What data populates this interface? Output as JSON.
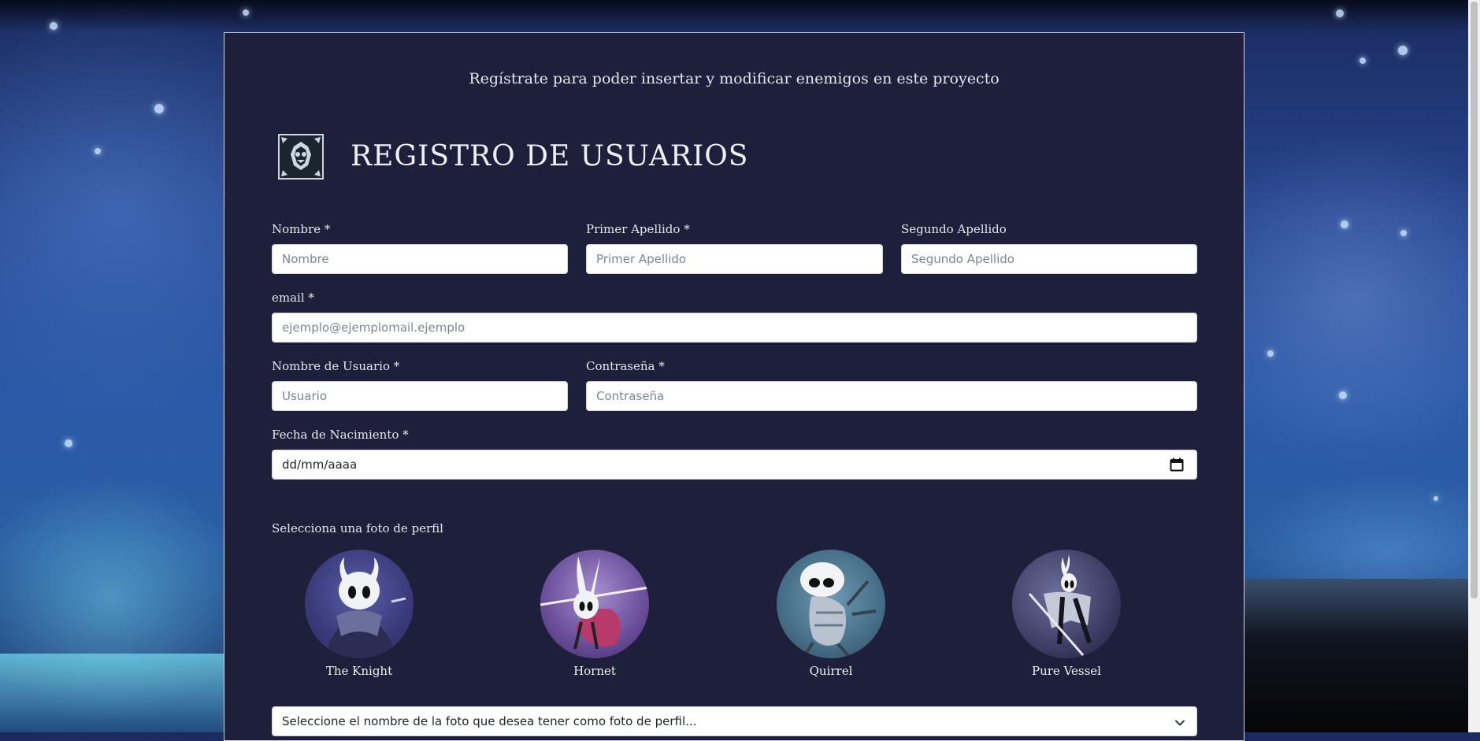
{
  "page": {
    "subtitle": "Regístrate para poder insertar y modificar enemigos en este proyecto",
    "title": "REGISTRO DE USUARIOS"
  },
  "form": {
    "nombre": {
      "label": "Nombre *",
      "placeholder": "Nombre"
    },
    "primer_apellido": {
      "label": "Primer Apellido *",
      "placeholder": "Primer Apellido"
    },
    "segundo_apellido": {
      "label": "Segundo Apellido",
      "placeholder": "Segundo Apellido"
    },
    "email": {
      "label": "email *",
      "placeholder": "ejemplo@ejemplomail.ejemplo"
    },
    "usuario": {
      "label": "Nombre de Usuario *",
      "placeholder": "Usuario"
    },
    "contrasena": {
      "label": "Contraseña *",
      "placeholder": "Contraseña"
    },
    "fecha": {
      "label": "Fecha de Nacimiento *",
      "value": "dd/mm/aaaa"
    }
  },
  "profile": {
    "section_label": "Selecciona una foto de perfil",
    "avatars": [
      {
        "name": "The Knight"
      },
      {
        "name": "Hornet"
      },
      {
        "name": "Quirrel"
      },
      {
        "name": "Pure Vessel"
      }
    ],
    "select_text": "Seleccione el nombre de la foto que desea tener como foto de perfil..."
  },
  "colors": {
    "card_bg": "#1e1f3a",
    "card_border": "#cfd4e6",
    "text_light": "#e5e7f0"
  }
}
